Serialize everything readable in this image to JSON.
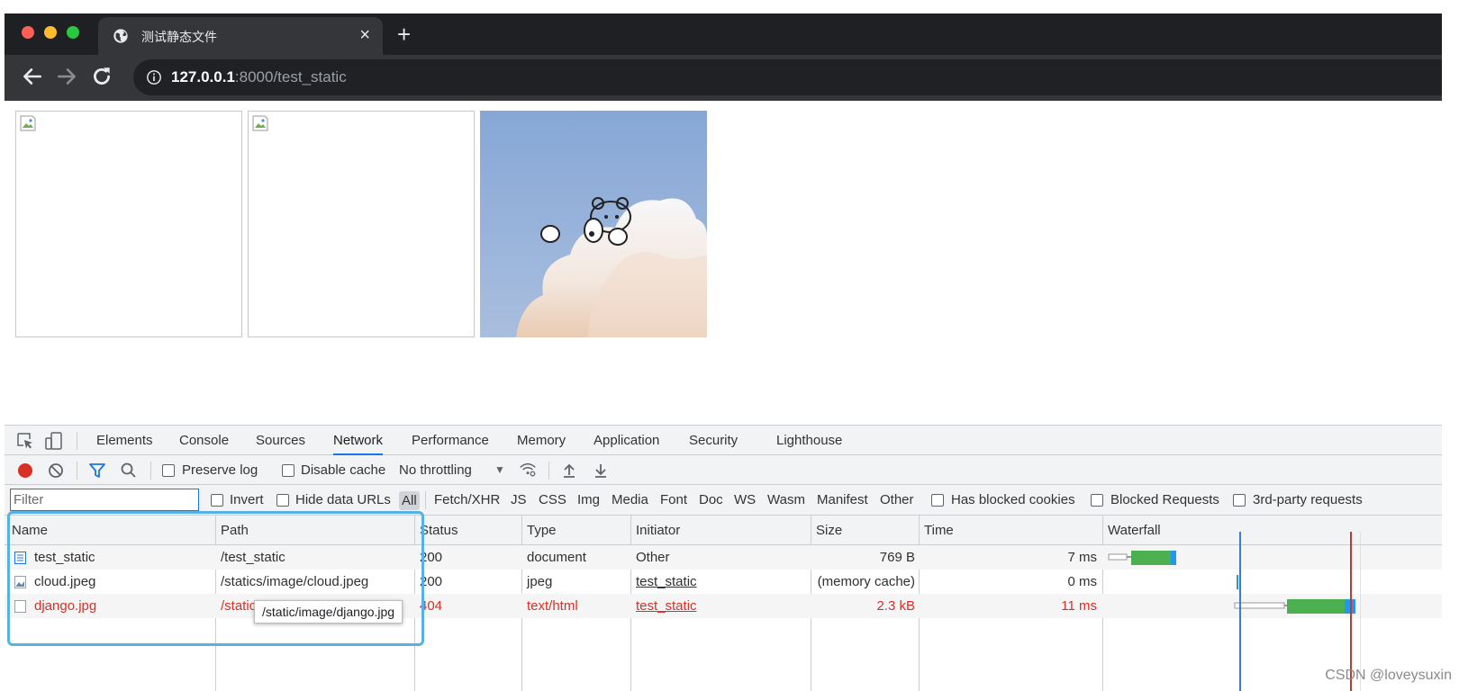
{
  "browser": {
    "tab_title": "测试静态文件",
    "tab_close": "×",
    "new_tab": "+",
    "url_host": "127.0.0.1",
    "url_rest": ":8000/test_static"
  },
  "devtools": {
    "tabs": [
      "Elements",
      "Console",
      "Sources",
      "Network",
      "Performance",
      "Memory",
      "Application",
      "Security",
      "Lighthouse"
    ],
    "active_tab": "Network",
    "toolbar": {
      "preserve_log": "Preserve log",
      "disable_cache": "Disable cache",
      "throttling": "No throttling",
      "throttling_arrow": "▼"
    },
    "filter_bar": {
      "placeholder": "Filter",
      "invert": "Invert",
      "hide_data_urls": "Hide data URLs",
      "types": [
        "All",
        "Fetch/XHR",
        "JS",
        "CSS",
        "Img",
        "Media",
        "Font",
        "Doc",
        "WS",
        "Wasm",
        "Manifest",
        "Other"
      ],
      "has_blocked_cookies": "Has blocked cookies",
      "blocked_requests": "Blocked Requests",
      "third_party": "3rd-party requests"
    },
    "columns": [
      "Name",
      "Path",
      "Status",
      "Type",
      "Initiator",
      "Size",
      "Time",
      "Waterfall"
    ],
    "rows": [
      {
        "name": "test_static",
        "path": "/test_static",
        "status": "200",
        "type": "document",
        "initiator": "Other",
        "size": "769 B",
        "time": "7 ms",
        "error": false
      },
      {
        "name": "cloud.jpeg",
        "path": "/statics/image/cloud.jpeg",
        "status": "200",
        "type": "jpeg",
        "initiator": "test_static",
        "size": "(memory cache)",
        "time": "0 ms",
        "error": false
      },
      {
        "name": "django.jpg",
        "path": "/static/image/django.jpg",
        "status": "404",
        "type": "text/html",
        "initiator": "test_static",
        "size": "2.3 kB",
        "time": "11 ms",
        "error": true
      }
    ],
    "tooltip": "/static/image/django.jpg"
  },
  "colors": {
    "error": "#d93025",
    "active_tab_underline": "#1a73e8",
    "highlight_box": "#56b0ea",
    "waterfall_green": "#4caf50",
    "waterfall_blue": "#2196f3"
  },
  "watermark": "CSDN @loveysuxin"
}
